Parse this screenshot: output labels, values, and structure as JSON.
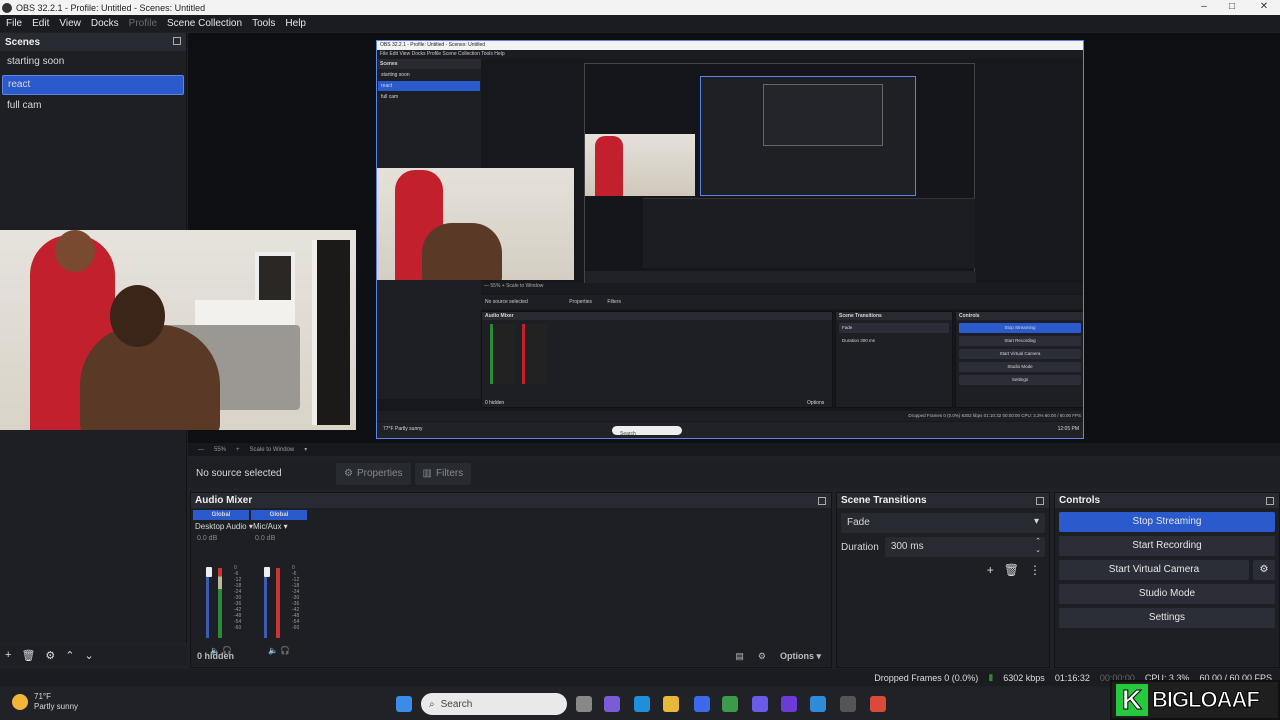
{
  "window": {
    "title": "OBS 32.2.1 - Profile: Untitled - Scenes: Untitled"
  },
  "menu": [
    "File",
    "Edit",
    "View",
    "Docks",
    "Profile",
    "Scene Collection",
    "Tools",
    "Help"
  ],
  "scenes": {
    "title": "Scenes",
    "items": [
      "starting soon",
      "react",
      "full cam"
    ],
    "selected": "react"
  },
  "nested": {
    "title": "OBS 32.2.1 - Profile: Untitled - Scenes: Untitled",
    "menu": "File   Edit   View   Docks   Profile   Scene Collection   Tools   Help",
    "scenes_title": "Scenes",
    "scene_items": [
      "starting soon",
      "react",
      "full cam"
    ],
    "toolbar": "—  55%  +  Scale to Window",
    "no_source": "No source selected",
    "properties": "Properties",
    "filters": "Filters",
    "mixer_title": "Audio Mixer",
    "transitions_title": "Scene Transitions",
    "fade": "Fade",
    "duration": "Duration   300 ms",
    "controls_title": "Controls",
    "buttons": [
      "Stop Streaming",
      "Start Recording",
      "Start Virtual Camera",
      "Studio Mode",
      "Settings"
    ],
    "hidden": "0 hidden",
    "options": "Options",
    "status": "Dropped Frames 0 (0.0%)   6302 kbps   01:10:32   00:00:00   CPU: 3.3%   60.00 / 60.00 FPS",
    "weather": "77°F  Partly sunny",
    "search": "Search",
    "clock": "12:05 PM"
  },
  "preview_toolbar": {
    "zoom_out": "—",
    "zoom": "55%",
    "zoom_in": "+",
    "scale": "Scale to Window"
  },
  "source_bar": {
    "no_source": "No source selected",
    "properties": "Properties",
    "filters": "Filters"
  },
  "mixer": {
    "title": "Audio Mixer",
    "channels": [
      {
        "group": "Global",
        "name": "Desktop Audio",
        "db": "0.0 dB"
      },
      {
        "group": "Global",
        "name": "Mic/Aux",
        "db": "0.0 dB"
      }
    ],
    "scale": [
      "0",
      "-6",
      "-12",
      "-18",
      "-24",
      "-30",
      "-36",
      "-42",
      "-48",
      "-54",
      "-60"
    ],
    "hidden": "0 hidden",
    "options": "Options"
  },
  "transitions": {
    "title": "Scene Transitions",
    "type": "Fade",
    "duration_label": "Duration",
    "duration": "300 ms"
  },
  "controls": {
    "title": "Controls",
    "buttons": [
      "Stop Streaming",
      "Start Recording",
      "Start Virtual Camera",
      "Studio Mode",
      "Settings"
    ]
  },
  "status": {
    "dropped": "Dropped Frames 0 (0.0%)",
    "kbps": "6302 kbps",
    "stream_time": "01:16:32",
    "rec_time": "00:00:00",
    "cpu": "CPU: 3.3%",
    "fps": "60.00 / 60.00 FPS"
  },
  "taskbar": {
    "temp": "71°F",
    "weather": "Partly sunny",
    "search": "Search"
  },
  "logo": {
    "letter": "K",
    "text": "BIGLOAAF"
  },
  "colors": {
    "accent": "#2a5acb",
    "panel": "#1d1f25",
    "header": "#272a31"
  }
}
